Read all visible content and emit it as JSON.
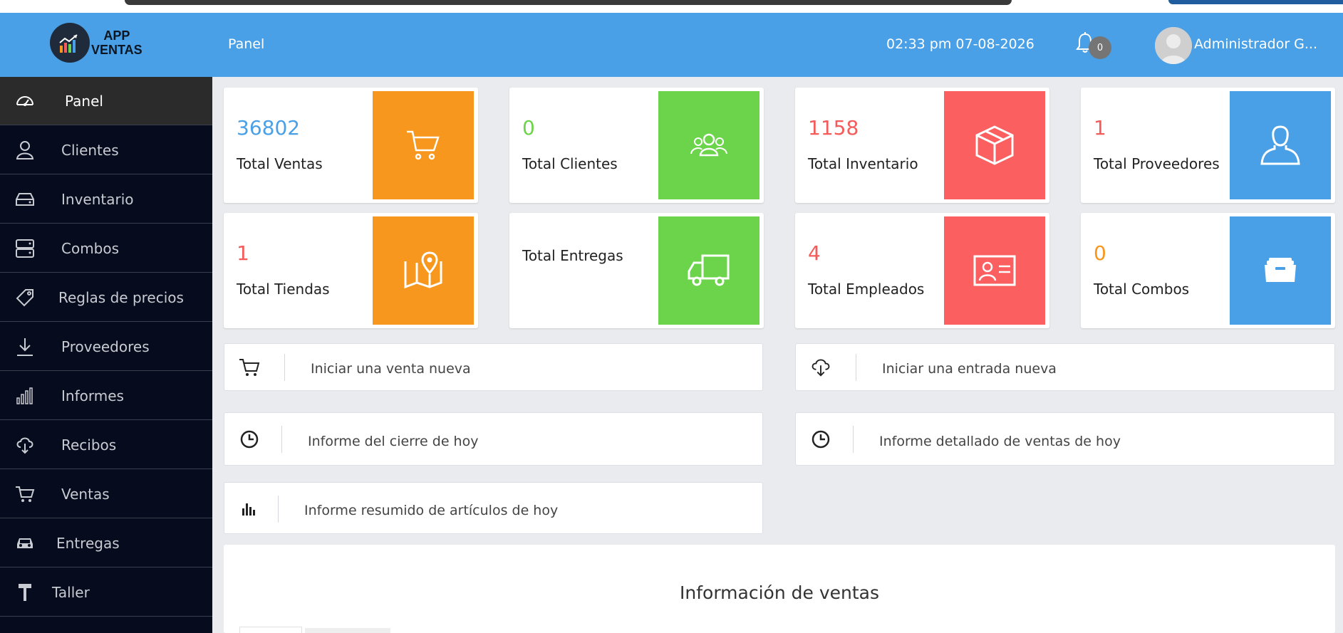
{
  "header": {
    "logo_line1": "APP",
    "logo_line2": "VENTAS",
    "title": "Panel",
    "clock": "02:33 pm 07-08-2026",
    "notification_count": "0",
    "user_name": "Administrador G...",
    "bg_color": "#4aa0e6"
  },
  "sidebar": {
    "items": [
      {
        "label": "Panel",
        "icon": "dashboard-icon",
        "active": true
      },
      {
        "label": "Clientes",
        "icon": "user-icon"
      },
      {
        "label": "Inventario",
        "icon": "drive-icon"
      },
      {
        "label": "Combos",
        "icon": "server-icon"
      },
      {
        "label": "Reglas de precios",
        "icon": "tag-icon"
      },
      {
        "label": "Proveedores",
        "icon": "download-icon"
      },
      {
        "label": "Informes",
        "icon": "bar-chart-icon"
      },
      {
        "label": "Recibos",
        "icon": "cloud-download-icon"
      },
      {
        "label": "Ventas",
        "icon": "cart-icon"
      },
      {
        "label": "Entregas",
        "icon": "car-icon"
      },
      {
        "label": "Taller",
        "icon": "hammer-icon"
      }
    ]
  },
  "cards": [
    {
      "value": "36802",
      "label": "Total Ventas",
      "value_color": "#4aa0e6",
      "tile_color": "#f7971e",
      "icon": "cart-icon"
    },
    {
      "value": "0",
      "label": "Total Clientes",
      "value_color": "#6cd44a",
      "tile_color": "#6cd44a",
      "icon": "users-icon"
    },
    {
      "value": "1158",
      "label": "Total Inventario",
      "value_color": "#f45b5b",
      "tile_color": "#fb5f5f",
      "icon": "box-icon"
    },
    {
      "value": "1",
      "label": "Total Proveedores",
      "value_color": "#f45b5b",
      "tile_color": "#4aa0e6",
      "icon": "user-icon"
    },
    {
      "value": "1",
      "label": "Total Tiendas",
      "value_color": "#f45b5b",
      "tile_color": "#f7971e",
      "icon": "map-icon"
    },
    {
      "value": "",
      "label": "Total Entregas",
      "value_color": "#6cd44a",
      "tile_color": "#6cd44a",
      "icon": "truck-icon"
    },
    {
      "value": "4",
      "label": "Total Empleados",
      "value_color": "#f45b5b",
      "tile_color": "#fb5f5f",
      "icon": "id-card-icon"
    },
    {
      "value": "0",
      "label": "Total Combos",
      "value_color": "#f7971e",
      "tile_color": "#4aa0e6",
      "icon": "inbox-icon"
    }
  ],
  "actions": [
    {
      "label": "Iniciar una venta nueva",
      "icon": "cart-icon"
    },
    {
      "label": "Iniciar una entrada nueva",
      "icon": "cloud-download-icon"
    },
    {
      "label": "Informe del cierre de hoy",
      "icon": "clock-icon"
    },
    {
      "label": "Informe detallado de ventas de hoy",
      "icon": "clock-icon"
    },
    {
      "label": "Informe resumido de artículos de hoy",
      "icon": "bar-chart-icon"
    }
  ],
  "sales_panel": {
    "title": "Información de ventas"
  }
}
